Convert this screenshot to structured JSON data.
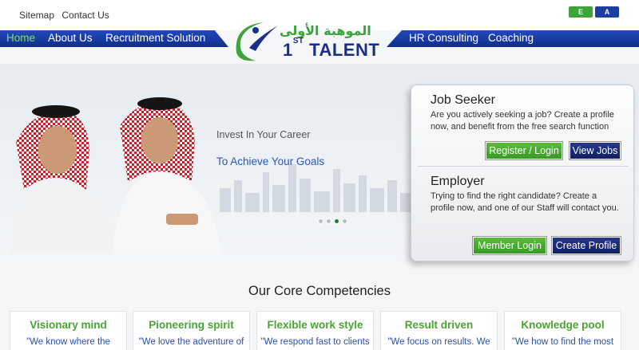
{
  "toplinks": {
    "sitemap": "Sitemap",
    "contact": "Contact Us"
  },
  "lang": {
    "en": "E",
    "ar": "A"
  },
  "nav": {
    "left": [
      "Home",
      "About Us",
      "Recruitment Solution"
    ],
    "right": [
      "HR Consulting",
      "Coaching"
    ],
    "active": "Home"
  },
  "logo": {
    "arabic": "الموهبة الأولى",
    "number": "1",
    "sup": "ST",
    "word": "TALENT"
  },
  "hero": {
    "tagline1": "Invest In Your Career",
    "tagline2": "To Achieve Your Goals",
    "slides": 4,
    "active_slide": 3
  },
  "panel": {
    "seeker": {
      "title": "Job Seeker",
      "text": "Are you actively seeking a job? Create a profile now, and benefit from the free search function",
      "btn1": "Register / Login",
      "btn2": "View Jobs"
    },
    "employer": {
      "title": "Employer",
      "text": "Trying to find the right candidate? Create a profile now, and one of our Staff will contact you.",
      "btn1": "Member Login",
      "btn2": "Create Profile"
    }
  },
  "core": {
    "title": "Our Core Competencies",
    "cards": [
      {
        "title": "Visionary mind",
        "text": "\"We know where the"
      },
      {
        "title": "Pioneering spirit",
        "text": "\"We love the adventure of"
      },
      {
        "title": "Flexible work style",
        "text": "\"We respond fast to clients"
      },
      {
        "title": "Result driven",
        "text": "\"We focus on results. We"
      },
      {
        "title": "Knowledge pool",
        "text": "\"We how to find the most"
      }
    ]
  },
  "colors": {
    "nav_blue": "#1a3aa6",
    "accent_green": "#49a532",
    "link_blue": "#2a57b8",
    "navy_button": "#0f1f66"
  }
}
